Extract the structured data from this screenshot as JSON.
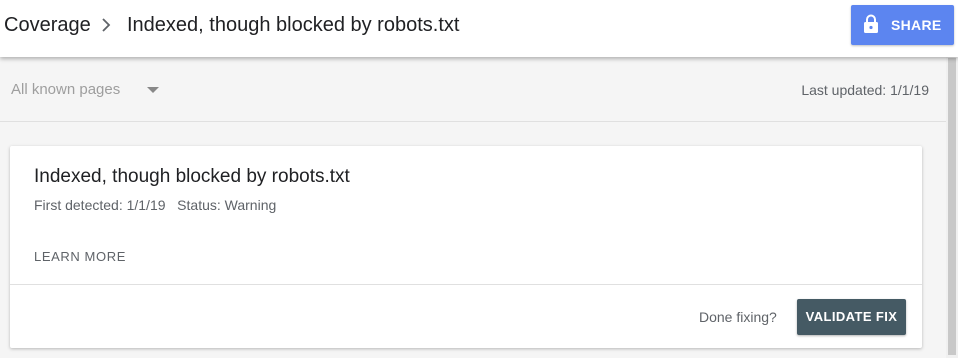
{
  "header": {
    "breadcrumb_root": "Coverage",
    "breadcrumb_current": "Indexed, though blocked by robots.txt",
    "share_label": "SHARE",
    "share_icon": "lock-icon"
  },
  "filter": {
    "selected": "All known pages",
    "last_updated": "Last updated: 1/1/19"
  },
  "card": {
    "title": "Indexed, though blocked by robots.txt",
    "meta": "First detected: 1/1/19   Status: Warning",
    "learn_more": "LEARN MORE",
    "done_fixing": "Done fixing?",
    "validate_label": "VALIDATE FIX"
  },
  "colors": {
    "share_button": "#5c85f0",
    "validate_button": "#455a64",
    "background": "#f5f5f5"
  }
}
